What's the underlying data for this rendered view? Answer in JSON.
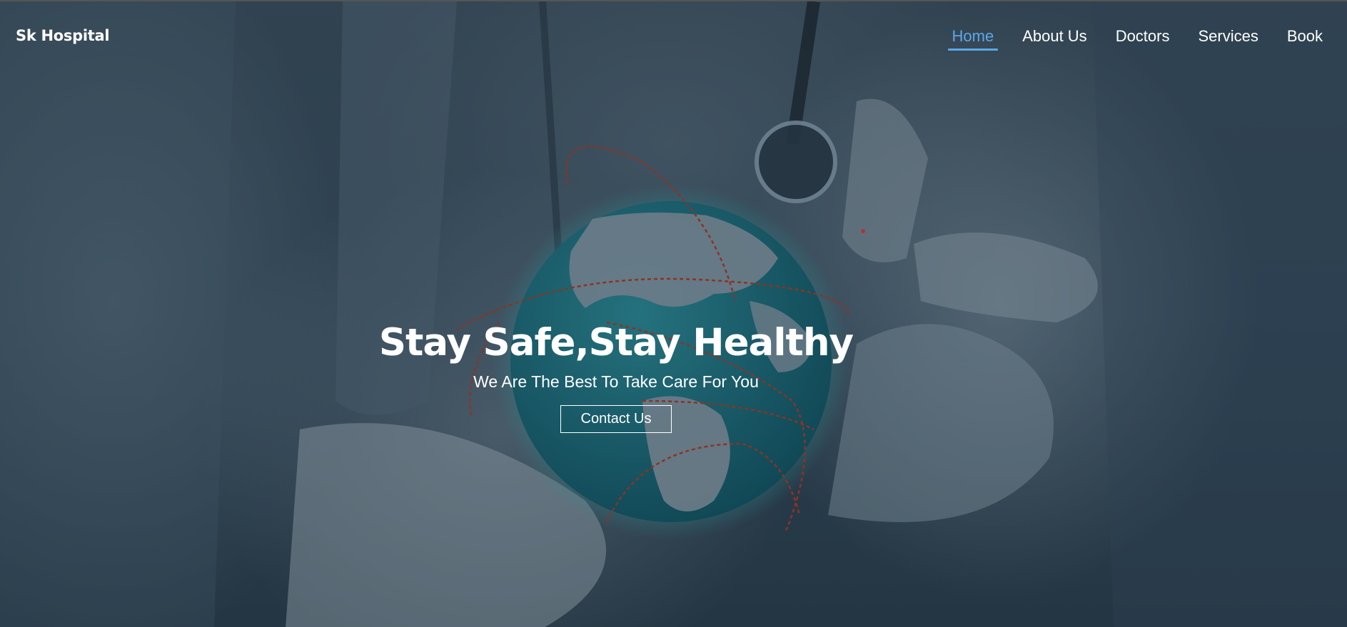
{
  "navbar": {
    "brand": "Sk Hospital",
    "items": [
      {
        "label": "Home",
        "active": true
      },
      {
        "label": "About Us",
        "active": false
      },
      {
        "label": "Doctors",
        "active": false
      },
      {
        "label": "Services",
        "active": false
      },
      {
        "label": "Book",
        "active": false
      }
    ]
  },
  "hero": {
    "title": "Stay Safe,Stay Healthy",
    "subtitle": "We Are The Best To Take Care For You",
    "button_label": "Contact Us"
  },
  "colors": {
    "accent": "#5aa8e8",
    "globe": "#1e6e7c",
    "route": "#b33a1e",
    "text": "#ffffff"
  }
}
